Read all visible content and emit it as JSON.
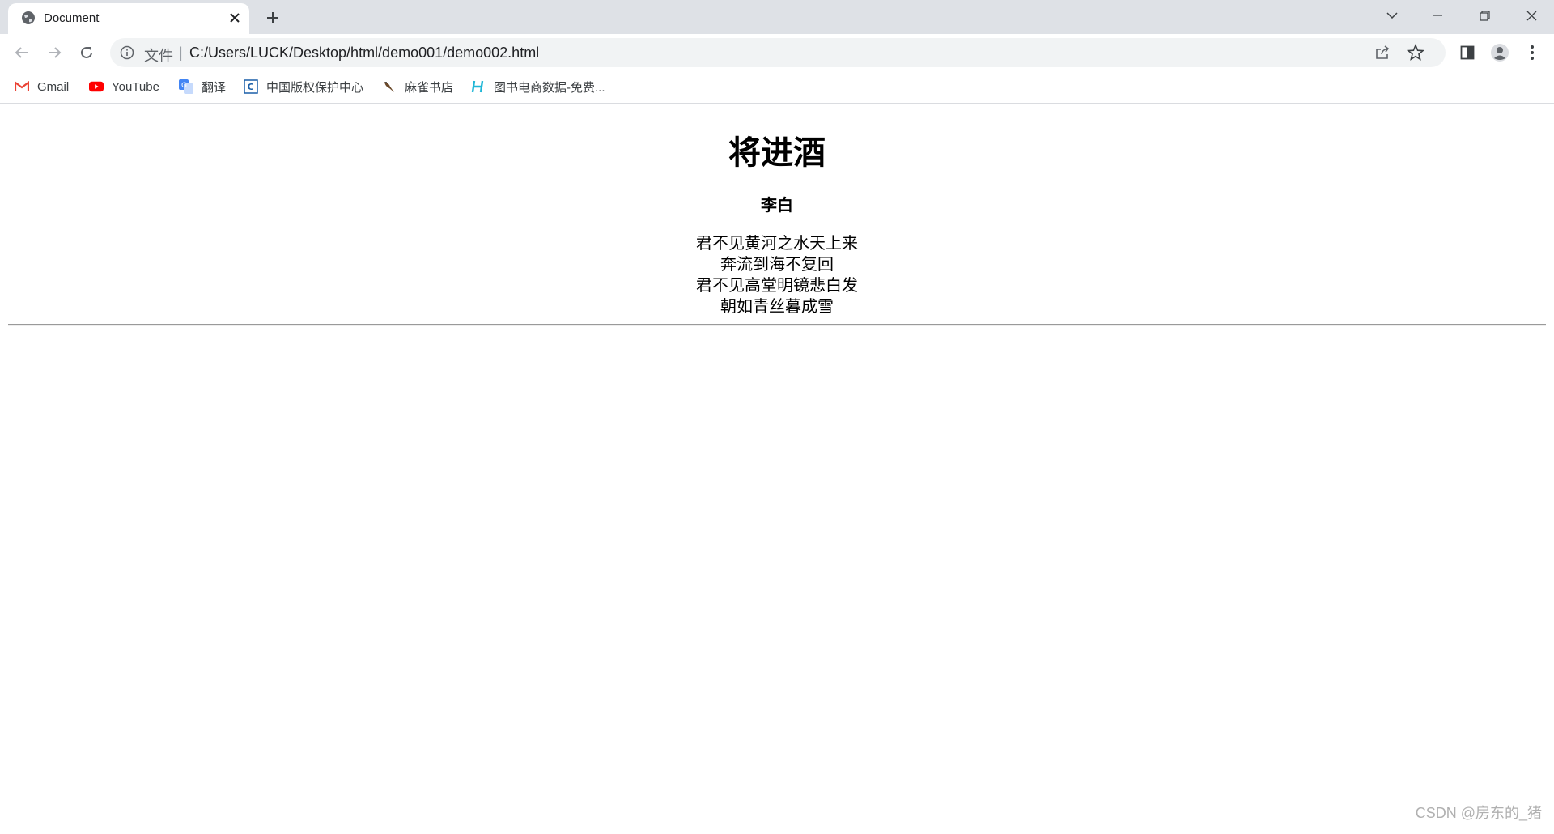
{
  "browser": {
    "tab": {
      "title": "Document",
      "favicon": "globe-icon"
    },
    "new_tab_icon": "plus-icon",
    "window_controls": [
      "chevron-down-icon",
      "minimize-icon",
      "restore-icon",
      "close-icon"
    ],
    "address": {
      "scheme_label": "文件",
      "separator": "|",
      "url": "C:/Users/LUCK/Desktop/html/demo001/demo002.html"
    },
    "bookmarks": [
      {
        "label": "Gmail",
        "icon": "gmail-icon"
      },
      {
        "label": "YouTube",
        "icon": "youtube-icon"
      },
      {
        "label": "翻译",
        "icon": "translate-icon"
      },
      {
        "label": "中国版权保护中心",
        "icon": "copyright-center-icon"
      },
      {
        "label": "麻雀书店",
        "icon": "sparrow-icon"
      },
      {
        "label": "图书电商数据-免费...",
        "icon": "h-logo-icon"
      }
    ]
  },
  "page": {
    "title": "将进酒",
    "author": "李白",
    "lines": [
      "君不见黄河之水天上来",
      "奔流到海不复回",
      "君不见高堂明镜悲白发",
      "朝如青丝暮成雪"
    ]
  },
  "watermark": "CSDN @房东的_猪",
  "colors": {
    "tabstrip_bg": "#dee1e6",
    "omnibox_bg": "#f1f3f4",
    "youtube_red": "#ff0000",
    "gmail_red": "#ea4335"
  }
}
